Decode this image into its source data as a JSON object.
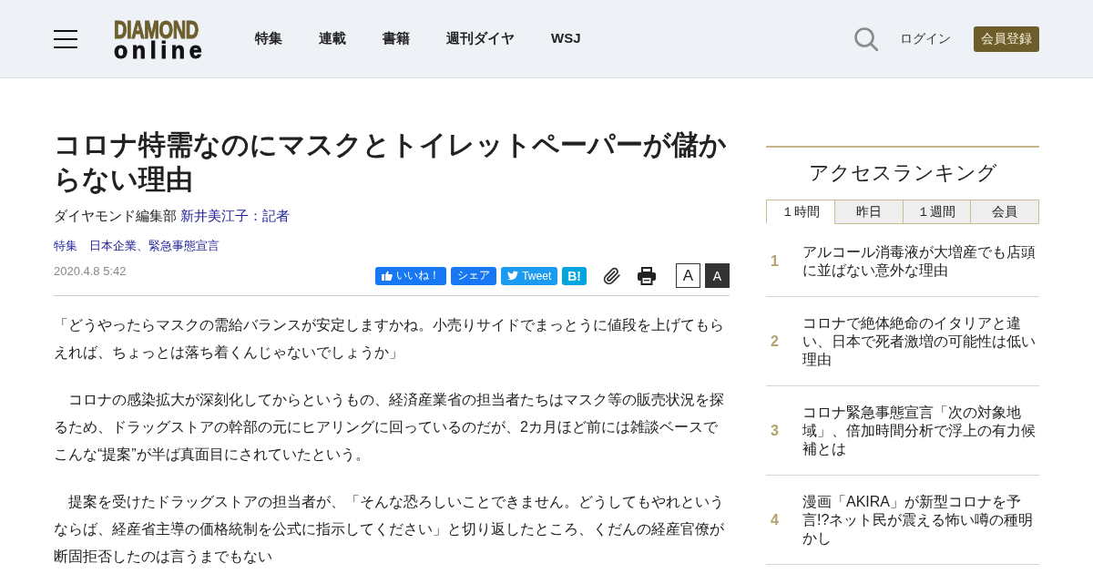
{
  "header": {
    "logo": {
      "top": "DIAMOND",
      "bottom": "online"
    },
    "nav": [
      {
        "label": "特集"
      },
      {
        "label": "連載"
      },
      {
        "label": "書籍"
      },
      {
        "label": "週刊ダイヤ"
      },
      {
        "label": "WSJ"
      }
    ],
    "login": "ログイン",
    "register": "会員登録"
  },
  "article": {
    "title": "コロナ特需なのにマスクとトイレットペーパーが儲からない理由",
    "byline": {
      "department": "ダイヤモンド編集部",
      "author": "新井美江子：記者"
    },
    "tags": [
      "特集",
      "日本企業、緊急事態宣言"
    ],
    "date": "2020.4.8 5:42",
    "share_buttons": [
      {
        "kind": "like",
        "label": "いいね！"
      },
      {
        "kind": "share",
        "label": "シェア"
      },
      {
        "kind": "tweet",
        "label": "Tweet"
      },
      {
        "kind": "hatena",
        "label": "B!"
      }
    ],
    "font_size_buttons": [
      {
        "label": "A",
        "selected": false
      },
      {
        "label": "A",
        "selected": true
      }
    ],
    "paragraphs": [
      "「どうやったらマスクの需給バランスが安定しますかね。小売りサイドでまっとうに値段を上げてもらえれば、ちょっとは落ち着くんじゃないでしょうか」",
      "　コロナの感染拡大が深刻化してからというもの、経済産業省の担当者たちはマスク等の販売状況を探るため、ドラッグストアの幹部の元にヒアリングに回っているのだが、2カ月ほど前には雑談ベースでこんな“提案”が半ば真面目にされていたという。",
      "　提案を受けたドラッグストアの担当者が、「そんな恐ろしいことできません。どうしてもやれというならば、経産省主導の価格統制を公式に指示してください」と切り返したところ、くだんの経産官僚が断固拒否したのは言うまでもない"
    ]
  },
  "sidebar": {
    "heading": "アクセスランキング",
    "tabs": [
      {
        "label": "１時間",
        "selected": true
      },
      {
        "label": "昨日",
        "selected": false
      },
      {
        "label": "１週間",
        "selected": false
      },
      {
        "label": "会員",
        "selected": false
      }
    ],
    "ranking": [
      {
        "rank": "1",
        "title": "アルコール消毒液が大増産でも店頭に並ばない意外な理由"
      },
      {
        "rank": "2",
        "title": "コロナで絶体絶命のイタリアと違い、日本で死者激増の可能性は低い理由"
      },
      {
        "rank": "3",
        "title": "コロナ緊急事態宣言「次の対象地域」、倍加時間分析で浮上の有力候補とは"
      },
      {
        "rank": "4",
        "title": "漫画「AKIRA」が新型コロナを予言!?ネット民が震える怖い噂の種明かし"
      }
    ]
  }
}
